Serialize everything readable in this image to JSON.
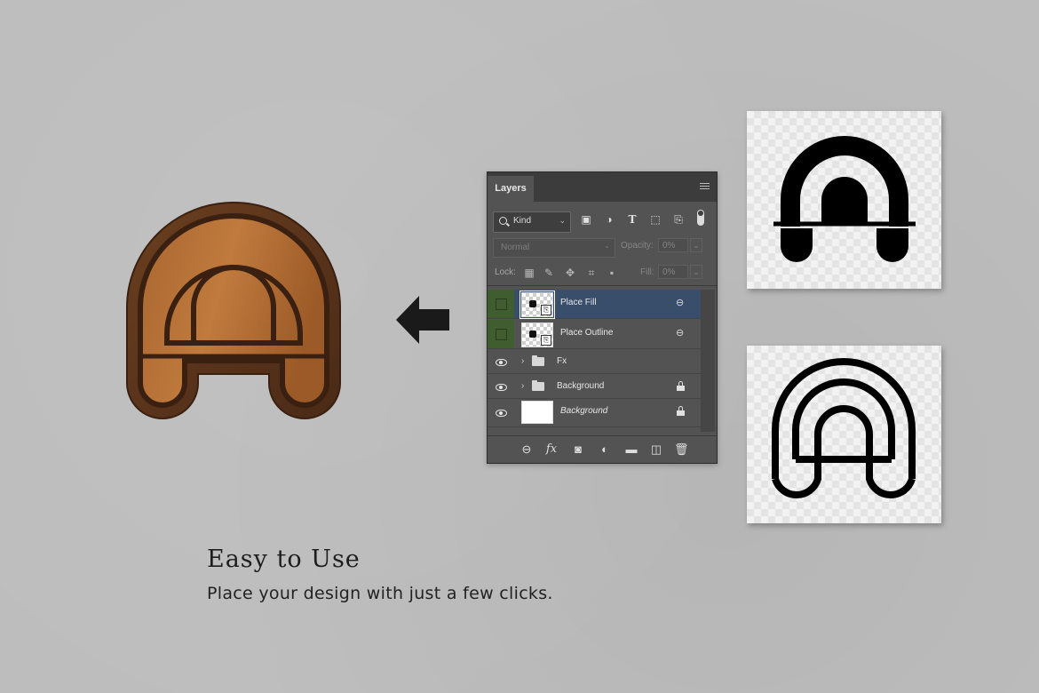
{
  "headline": {
    "title": "Easy to Use",
    "subtitle": "Place your design with just a few clicks."
  },
  "layers_panel": {
    "tab_label": "Layers",
    "filter": {
      "kind_label": "Kind",
      "icons": [
        "image-filter-icon",
        "adjustment-filter-icon",
        "type-filter-icon",
        "shape-filter-icon",
        "smart-object-filter-icon"
      ]
    },
    "blend_mode": "Normal",
    "opacity_label": "Opacity:",
    "opacity_value": "0%",
    "lock_label": "Lock:",
    "lock_icons": [
      "lock-pixels-icon",
      "lock-paint-icon",
      "lock-position-icon",
      "lock-artboard-icon",
      "lock-all-icon"
    ],
    "fill_label": "Fill:",
    "fill_value": "0%",
    "layers": [
      {
        "name": "Place Fill",
        "selected": true,
        "visible": false,
        "type": "smart-object",
        "linked": true
      },
      {
        "name": "Place Outline",
        "selected": false,
        "visible": false,
        "type": "smart-object",
        "linked": true
      },
      {
        "name": "Fx",
        "selected": false,
        "visible": true,
        "type": "group",
        "locked": false
      },
      {
        "name": "Background",
        "selected": false,
        "visible": true,
        "type": "group",
        "locked": true
      },
      {
        "name": "Background",
        "selected": false,
        "visible": true,
        "type": "background",
        "locked": true
      }
    ],
    "bottom_icons": [
      "link-layers-icon",
      "fx-icon",
      "mask-icon",
      "adjustment-layer-icon",
      "new-group-icon",
      "new-layer-icon",
      "trash-icon"
    ],
    "fx_glyph": "fx"
  },
  "colors": {
    "background": "#bdbdbd",
    "panel": "#535353",
    "selected_layer": "#384e6b",
    "visibility_green": "#405d2f",
    "wood": "#9a5a2a"
  }
}
